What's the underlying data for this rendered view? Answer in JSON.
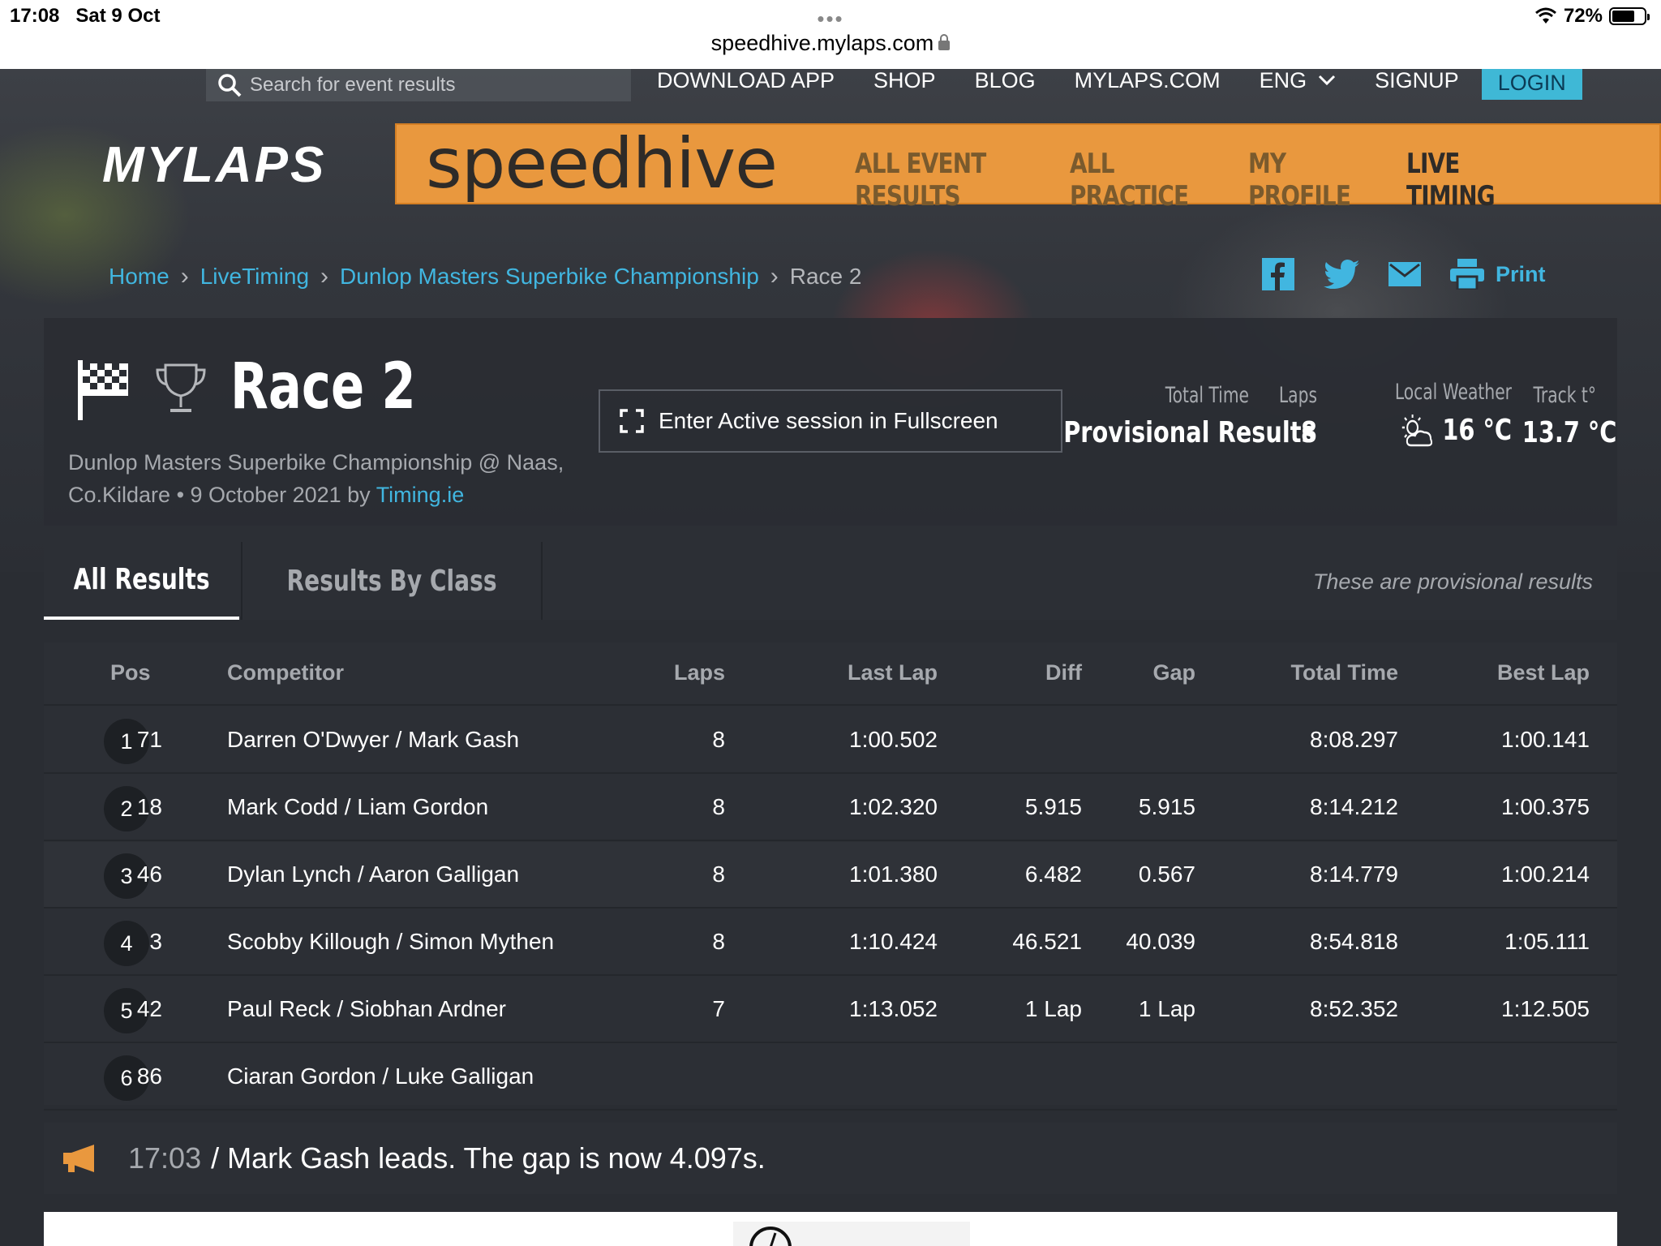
{
  "status_bar": {
    "time": "17:08",
    "date": "Sat 9 Oct",
    "battery": "72%",
    "battery_level": 0.72
  },
  "browser": {
    "url": "speedhive.mylaps.com"
  },
  "top_nav": {
    "search_placeholder": "Search for event results",
    "links": [
      "DOWNLOAD APP",
      "SHOP",
      "BLOG",
      "MYLAPS.COM"
    ],
    "language": "ENG",
    "signup": "SIGNUP",
    "login": "LOGIN"
  },
  "brand": {
    "mylaps": "MYLAPS",
    "speedhive": "speedhive"
  },
  "main_nav": {
    "items": [
      "ALL EVENT RESULTS",
      "ALL PRACTICE",
      "MY PROFILE",
      "LIVE TIMING"
    ],
    "active": "LIVE TIMING"
  },
  "breadcrumb": [
    "Home",
    "LiveTiming",
    "Dunlop Masters Superbike Championship",
    "Race 2"
  ],
  "share": {
    "print": "Print",
    "icons": [
      "facebook-icon",
      "twitter-icon",
      "email-icon",
      "print-icon"
    ]
  },
  "session": {
    "title": "Race 2",
    "subtitle": "Dunlop Masters Superbike Championship @ Naas, Co.Kildare • 9 October 2021 by",
    "organizer": "Timing.ie",
    "fullscreen_button": "Enter Active session in Fullscreen",
    "stats": {
      "total_time_label": "Total Time",
      "total_time_value": "Provisional Results",
      "laps_label": "Laps",
      "laps_value": "8",
      "weather_label": "Local Weather",
      "weather_value": "16 °C",
      "track_label": "Track t°",
      "track_value": "13.7 °C"
    }
  },
  "tabs": {
    "all": "All Results",
    "by_class": "Results By Class",
    "note": "These are provisional results"
  },
  "results": {
    "columns": [
      "Pos",
      "Competitor",
      "Laps",
      "Last Lap",
      "Diff",
      "Gap",
      "Total Time",
      "Best Lap"
    ],
    "rows": [
      {
        "pos": "1",
        "num": "71",
        "competitor": "Darren O'Dwyer / Mark Gash",
        "laps": "8",
        "last_lap": "1:00.502",
        "diff": "",
        "gap": "",
        "total": "8:08.297",
        "best": "1:00.141"
      },
      {
        "pos": "2",
        "num": "18",
        "competitor": "Mark Codd / Liam Gordon",
        "laps": "8",
        "last_lap": "1:02.320",
        "diff": "5.915",
        "gap": "5.915",
        "total": "8:14.212",
        "best": "1:00.375"
      },
      {
        "pos": "3",
        "num": "46",
        "competitor": "Dylan Lynch / Aaron Galligan",
        "laps": "8",
        "last_lap": "1:01.380",
        "diff": "6.482",
        "gap": "0.567",
        "total": "8:14.779",
        "best": "1:00.214"
      },
      {
        "pos": "4",
        "num": "3",
        "competitor": "Scobby Killough / Simon Mythen",
        "laps": "8",
        "last_lap": "1:10.424",
        "diff": "46.521",
        "gap": "40.039",
        "total": "8:54.818",
        "best": "1:05.111"
      },
      {
        "pos": "5",
        "num": "42",
        "competitor": "Paul Reck / Siobhan Ardner",
        "laps": "7",
        "last_lap": "1:13.052",
        "diff": "1 Lap",
        "gap": "1 Lap",
        "total": "8:52.352",
        "best": "1:12.505"
      },
      {
        "pos": "6",
        "num": "86",
        "competitor": "Ciaran Gordon / Luke Galligan",
        "laps": "",
        "last_lap": "",
        "diff": "",
        "gap": "",
        "total": "",
        "best": ""
      }
    ]
  },
  "announcement": {
    "time": "17:03",
    "message": "/ Mark Gash leads. The gap is now 4.097s."
  },
  "colors": {
    "accent": "#e9983e",
    "link": "#41b6e0",
    "login": "#3fb8d6",
    "panel": "#2c2f35"
  }
}
